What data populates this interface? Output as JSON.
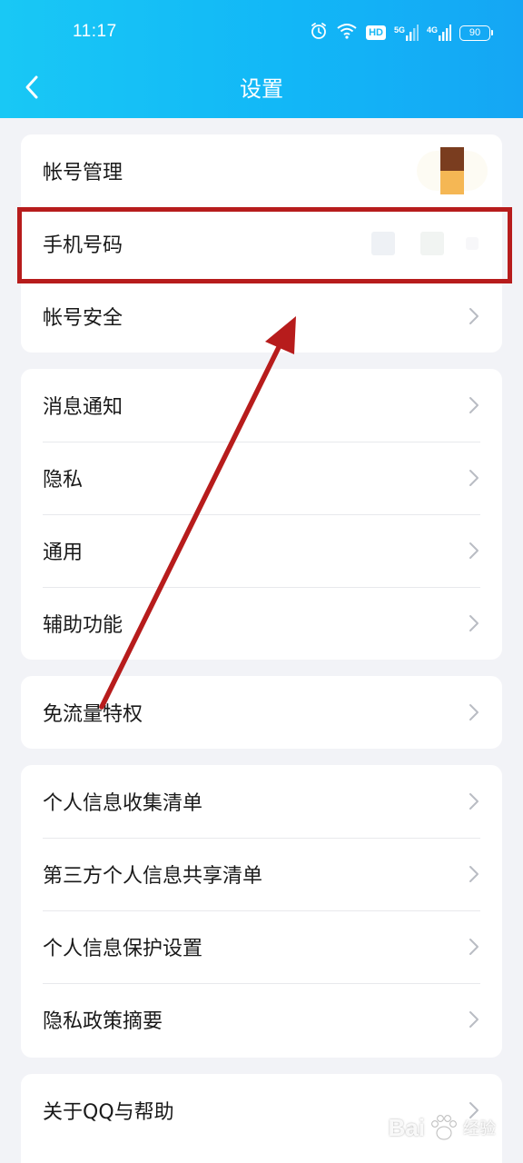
{
  "status_bar": {
    "time": "11:17",
    "hd_label": "HD",
    "sim1_label": "5G",
    "sim2_label": "4G",
    "battery": "90"
  },
  "nav": {
    "title": "设置"
  },
  "groups": [
    {
      "items": [
        {
          "label": "帐号管理"
        },
        {
          "label": "手机号码"
        },
        {
          "label": "帐号安全"
        }
      ]
    },
    {
      "items": [
        {
          "label": "消息通知"
        },
        {
          "label": "隐私"
        },
        {
          "label": "通用"
        },
        {
          "label": "辅助功能"
        }
      ]
    },
    {
      "items": [
        {
          "label": "免流量特权"
        }
      ]
    },
    {
      "items": [
        {
          "label": "个人信息收集清单"
        },
        {
          "label": "第三方个人信息共享清单"
        },
        {
          "label": "个人信息保护设置"
        },
        {
          "label": "隐私政策摘要"
        }
      ]
    },
    {
      "items": [
        {
          "label": "关于QQ与帮助"
        }
      ]
    }
  ],
  "watermark": {
    "brand": "Bai",
    "suffix": "经验"
  },
  "colors": {
    "header_start": "#19c8f5",
    "header_end": "#15a6f4",
    "annotation": "#b71c1c",
    "background": "#f2f3f7"
  }
}
